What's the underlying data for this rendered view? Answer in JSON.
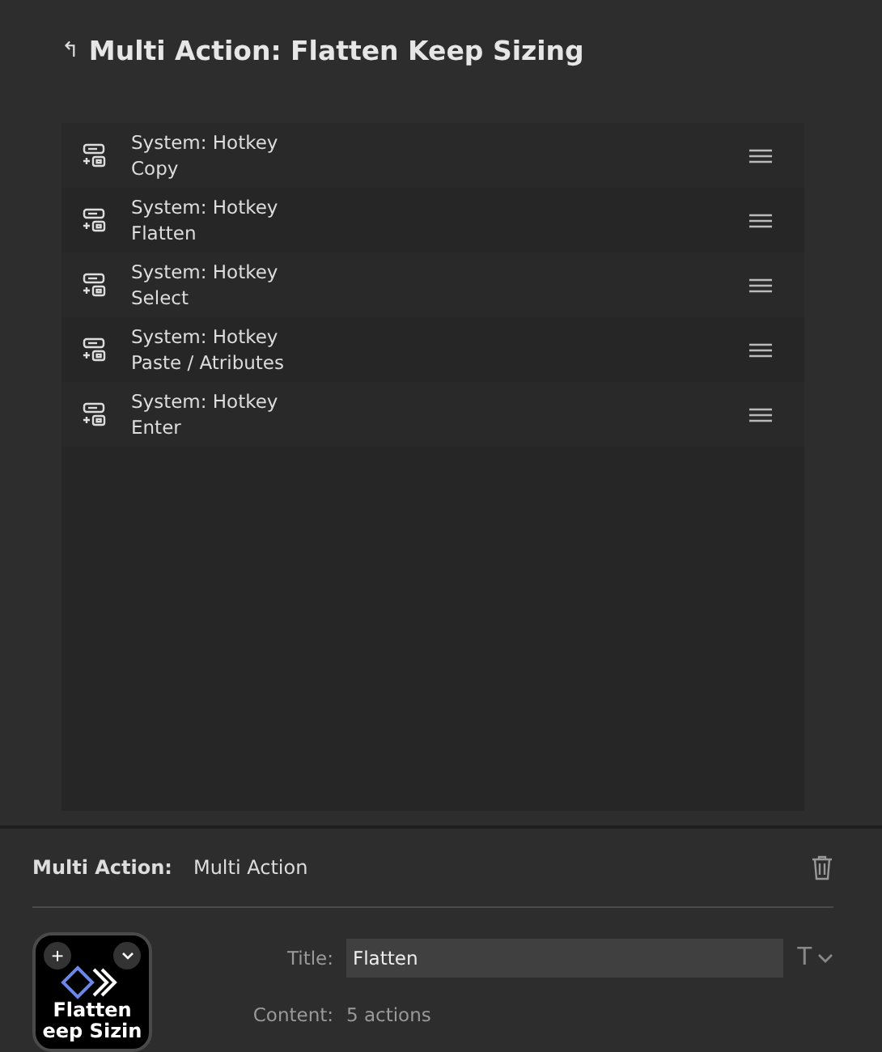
{
  "header": {
    "back_icon": "↰",
    "title": "Multi Action: Flatten Keep Sizing"
  },
  "actions": [
    {
      "title": "System: Hotkey",
      "subtitle": "Copy"
    },
    {
      "title": "System: Hotkey",
      "subtitle": "Flatten"
    },
    {
      "title": "System: Hotkey",
      "subtitle": "Select"
    },
    {
      "title": "System: Hotkey",
      "subtitle": "Paste / Atributes"
    },
    {
      "title": "System: Hotkey",
      "subtitle": "Enter"
    }
  ],
  "properties": {
    "type_label": "Multi Action:",
    "type_value": "Multi Action",
    "key_image": {
      "add": "+",
      "line1": "Flatten",
      "line2": "eep Sizin"
    },
    "title_label": "Title:",
    "title_value": "Flatten",
    "font_button": "T",
    "content_label": "Content:",
    "content_value": "5 actions"
  }
}
